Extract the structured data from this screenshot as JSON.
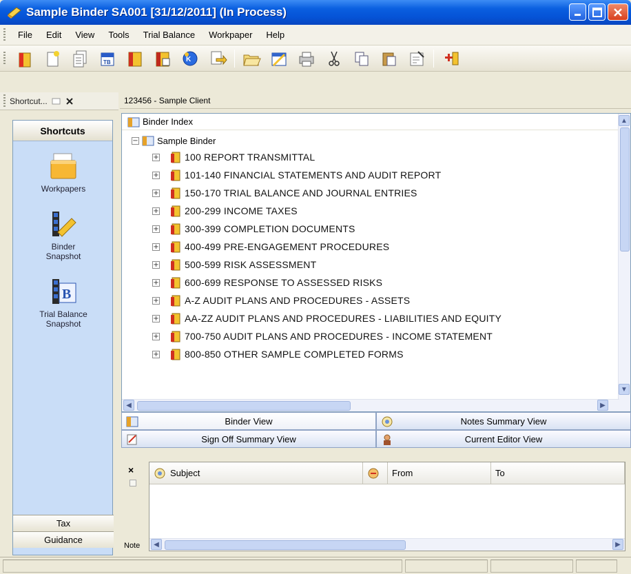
{
  "window": {
    "title": "Sample Binder SA001 [31/12/2011] (In Process)"
  },
  "menu": [
    "File",
    "Edit",
    "View",
    "Tools",
    "Trial Balance",
    "Workpaper",
    "Help"
  ],
  "toolbar": {
    "icons": [
      "new-workpaper-icon",
      "new-document-icon",
      "copy-document-icon",
      "trial-balance-icon",
      "binder-icon",
      "binder-copy-icon",
      "kc-icon",
      "export-icon",
      "open-folder-icon",
      "binder-open-icon",
      "print-icon",
      "cut-icon",
      "copy-icon",
      "paste-icon",
      "properties-icon",
      "add-icon"
    ]
  },
  "shortcut_panel": {
    "header": "Shortcut...",
    "title": "Shortcuts",
    "items": [
      {
        "label": "Workpapers"
      },
      {
        "label": "Binder Snapshot"
      },
      {
        "label": "Trial Balance Snapshot"
      }
    ],
    "bottom_buttons": [
      "Tax",
      "Guidance"
    ]
  },
  "client": "123456 - Sample Client",
  "tree": {
    "root": "Binder Index",
    "binder": "Sample Binder",
    "items": [
      "100 REPORT TRANSMITTAL",
      "101-140 FINANCIAL STATEMENTS AND AUDIT REPORT",
      "150-170 TRIAL BALANCE AND JOURNAL ENTRIES",
      "200-299 INCOME TAXES",
      "300-399 COMPLETION DOCUMENTS",
      "400-499 PRE-ENGAGEMENT PROCEDURES",
      "500-599 RISK ASSESSMENT",
      "600-699 RESPONSE TO ASSESSED RISKS",
      "A-Z AUDIT PLANS AND PROCEDURES - ASSETS",
      "AA-ZZ AUDIT PLANS AND PROCEDURES - LIABILITIES AND EQUITY",
      "700-750 AUDIT PLANS AND PROCEDURES - INCOME STATEMENT",
      "800-850 OTHER SAMPLE COMPLETED FORMS"
    ]
  },
  "views": {
    "binder": "Binder View",
    "notes_summary": "Notes Summary View",
    "sign_off": "Sign Off Summary View",
    "current_editor": "Current Editor View"
  },
  "notes": {
    "close": "×",
    "columns": [
      "Subject",
      "From",
      "To"
    ],
    "label": "Note"
  },
  "colors": {
    "titlebar": "#0553d6",
    "shortcut_bg": "#c9ddf7",
    "folder": "#f7b733"
  }
}
